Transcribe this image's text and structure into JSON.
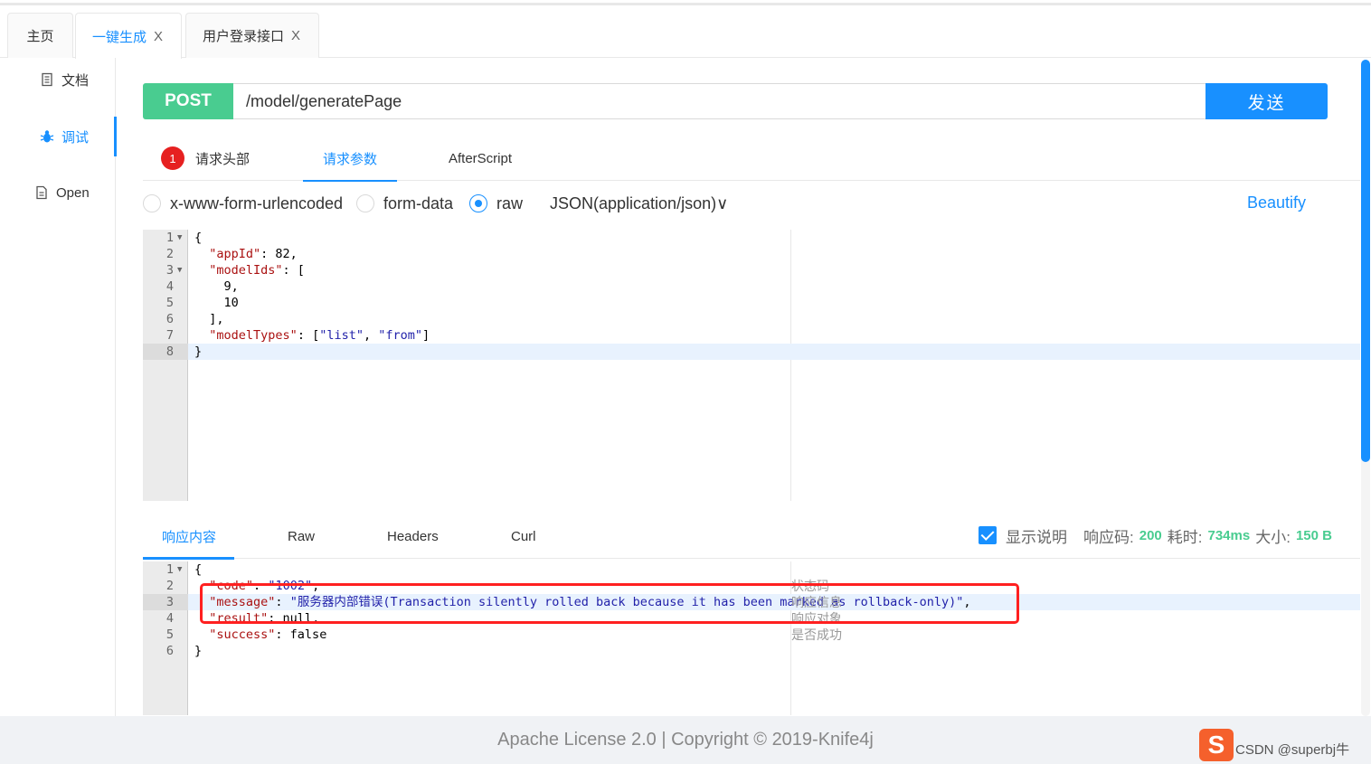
{
  "tabs": [
    {
      "label": "主页",
      "closable": false
    },
    {
      "label": "一键生成",
      "closable": true,
      "active": true
    },
    {
      "label": "用户登录接口",
      "closable": true
    }
  ],
  "close_glyph": "X",
  "sidebar": {
    "items": [
      {
        "label": "文档",
        "icon": "document-icon"
      },
      {
        "label": "调试",
        "icon": "bug-icon",
        "active": true
      },
      {
        "label": "Open",
        "icon": "file-icon"
      }
    ]
  },
  "request": {
    "method": "POST",
    "url": "/model/generatePage",
    "send_label": "发送",
    "tabs": [
      {
        "label": "请求头部",
        "badge": "1"
      },
      {
        "label": "请求参数",
        "active": true
      },
      {
        "label": "AfterScript"
      }
    ],
    "body_types": [
      {
        "label": "x-www-form-urlencoded",
        "checked": false
      },
      {
        "label": "form-data",
        "checked": false
      },
      {
        "label": "raw",
        "checked": true
      }
    ],
    "content_type": "JSON(application/json)∨",
    "beautify_label": "Beautify",
    "body_lines": [
      {
        "n": "1",
        "fold": true,
        "text": "{"
      },
      {
        "n": "2",
        "text": "  \"appId\": 82,"
      },
      {
        "n": "3",
        "fold": true,
        "text": "  \"modelIds\": ["
      },
      {
        "n": "4",
        "text": "    9,"
      },
      {
        "n": "5",
        "text": "    10"
      },
      {
        "n": "6",
        "text": "  ],"
      },
      {
        "n": "7",
        "text": "  \"modelTypes\": [\"list\", \"from\"]"
      },
      {
        "n": "8",
        "text": "}"
      }
    ]
  },
  "response": {
    "tabs": [
      {
        "label": "响应内容",
        "active": true
      },
      {
        "label": "Raw"
      },
      {
        "label": "Headers"
      },
      {
        "label": "Curl"
      }
    ],
    "show_desc_label": "显示说明",
    "status_label": "响应码:",
    "status_value": "200",
    "time_label": "耗时:",
    "time_value": "734ms",
    "size_label": "大小:",
    "size_value": "150 B",
    "lines": [
      {
        "n": "1",
        "fold": true,
        "text": "{"
      },
      {
        "n": "2",
        "text": "  \"code\": \"1002\","
      },
      {
        "n": "3",
        "text": "  \"message\": \"服务器内部错误(Transaction silently rolled back because it has been marked as rollback-only)\","
      },
      {
        "n": "4",
        "text": "  \"result\": null,"
      },
      {
        "n": "5",
        "text": "  \"success\": false"
      },
      {
        "n": "6",
        "text": "}"
      }
    ],
    "comments": [
      "状态码",
      "响应信息",
      "响应对象",
      "是否成功"
    ]
  },
  "footer": {
    "text": "Apache License 2.0 | Copyright © 2019-Knife4j",
    "logo_letter": "S",
    "watermark": "CSDN @superbj牛"
  },
  "colors": {
    "accent": "#1890ff",
    "post": "#49cc90",
    "badge": "#e62020",
    "highlight_box": "#ff2020"
  }
}
